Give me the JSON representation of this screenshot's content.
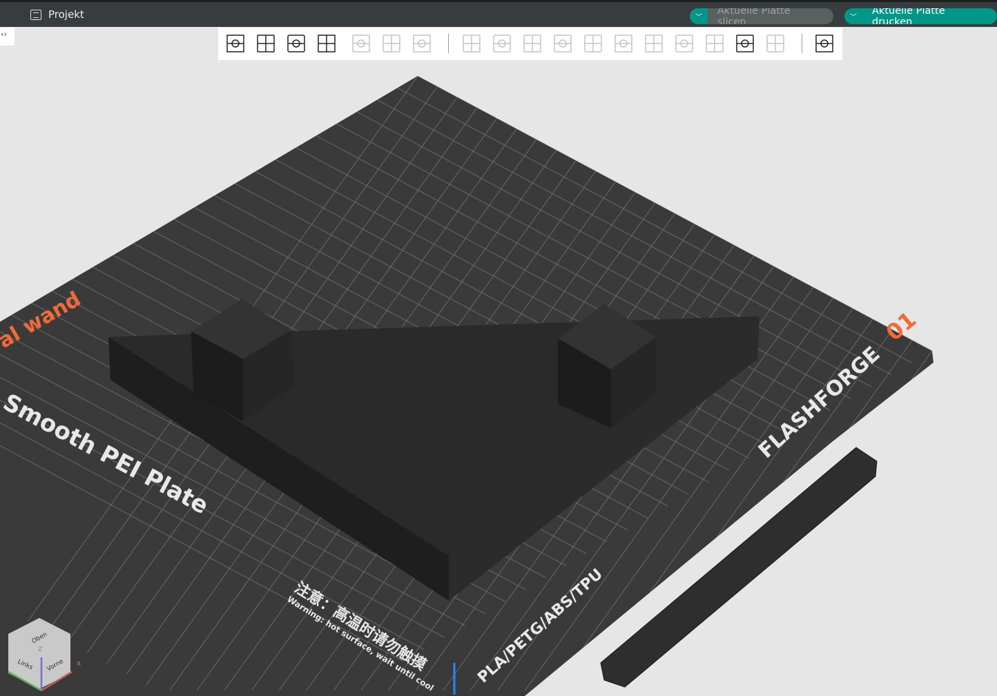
{
  "topbar": {
    "project_label": "Projekt",
    "slice_button": "Aktuelle Platte slicen",
    "print_button": "Aktuelle Platte drucken",
    "dropdown_glyph": "﹀"
  },
  "side_toggle": "‹›",
  "toolbar": {
    "tools": [
      {
        "name": "add-object",
        "enabled": true
      },
      {
        "name": "add-plate",
        "enabled": true
      },
      {
        "name": "auto-orient",
        "enabled": true
      },
      {
        "name": "arrange",
        "enabled": true
      },
      {
        "name": "split-objects",
        "enabled": false
      },
      {
        "name": "split-parts",
        "enabled": false
      },
      {
        "name": "layers",
        "enabled": false
      },
      {
        "name": "move",
        "enabled": false
      },
      {
        "name": "rotate",
        "enabled": false
      },
      {
        "name": "scale",
        "enabled": false
      },
      {
        "name": "lay-on-face",
        "enabled": false
      },
      {
        "name": "cut",
        "enabled": false
      },
      {
        "name": "boolean",
        "enabled": false
      },
      {
        "name": "support-paint",
        "enabled": false
      },
      {
        "name": "seam-paint",
        "enabled": false
      },
      {
        "name": "color-paint",
        "enabled": false
      },
      {
        "name": "text",
        "enabled": true
      },
      {
        "name": "measure",
        "enabled": false
      },
      {
        "name": "assembly",
        "enabled": true
      }
    ]
  },
  "plate": {
    "brand": "FLASHFORGE",
    "number": "01",
    "name": "Smooth PEI Plate",
    "edge_text": "al wand",
    "materials": "PLA/PETG/ABS/TPU",
    "warning_cn": "注意：高温时请勿触摸",
    "warning_en": "Warning: hot surface, wait until cool"
  },
  "view_cube": {
    "top": "Oben",
    "left": "Links",
    "front": "Vorne",
    "x": "X",
    "z": "Z"
  },
  "colors": {
    "accent": "#009688",
    "plate": "#3a3a3a",
    "model": "#262626"
  }
}
